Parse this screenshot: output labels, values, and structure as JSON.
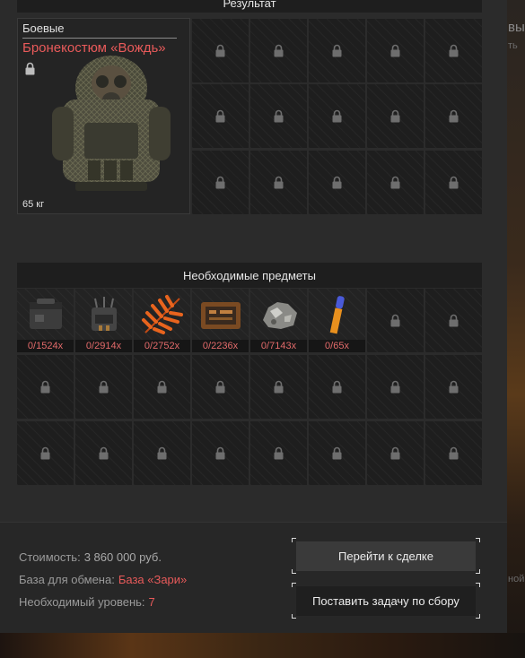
{
  "background": {
    "side_text_1": "вы",
    "side_text_2": "ть",
    "side_text_3": "ной"
  },
  "result": {
    "title": "Результат",
    "item": {
      "category": "Боевые",
      "name": "Бронекостюм «Вождь»",
      "weight": "65 кг",
      "icon": "armor-suit"
    }
  },
  "required": {
    "title": "Необходимые предметы",
    "items": [
      {
        "count": "0/1524x",
        "icon": "ammo-box"
      },
      {
        "count": "0/2914x",
        "icon": "electronic-device"
      },
      {
        "count": "0/2752x",
        "icon": "orange-fern"
      },
      {
        "count": "0/2236x",
        "icon": "circuit-board"
      },
      {
        "count": "0/7143x",
        "icon": "ore-chunk"
      },
      {
        "count": "0/65x",
        "icon": "cartridge"
      }
    ]
  },
  "info": {
    "cost_label": "Стоимость:",
    "cost_value": "3 860 000 руб.",
    "base_label": "База для обмена:",
    "base_value": "База «Зари»",
    "level_label": "Необходимый уровень:",
    "level_value": "7"
  },
  "buttons": {
    "deal": "Перейти к сделке",
    "task": "Поставить задачу по сбору"
  },
  "colors": {
    "accent_red": "#e85a5a",
    "panel_bg": "#2b2b2b",
    "cell_bg": "#1e1e1e"
  }
}
